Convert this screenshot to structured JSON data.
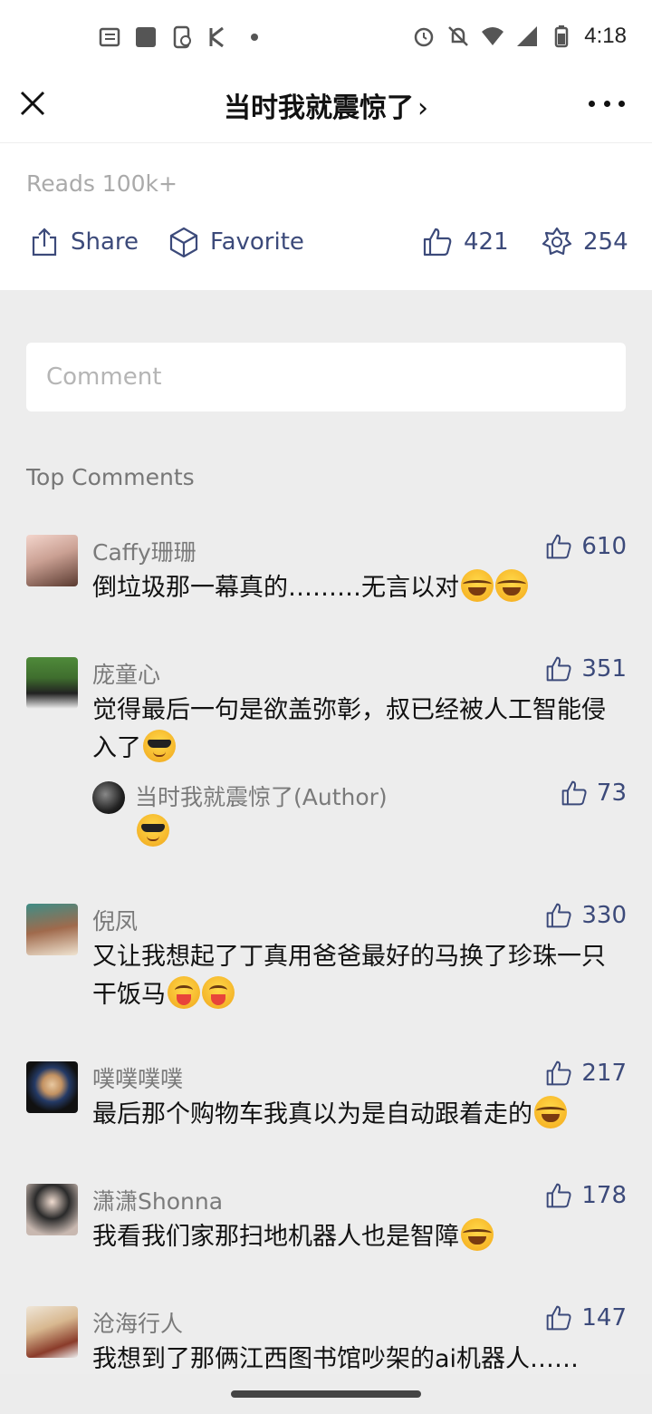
{
  "status_bar": {
    "time": "4:18"
  },
  "header": {
    "title": "当时我就震惊了",
    "chevron": "›"
  },
  "article": {
    "reads": "Reads 100k+"
  },
  "actions": {
    "share_label": "Share",
    "favorite_label": "Favorite",
    "like_count": "421",
    "wow_count": "254"
  },
  "comment_input": {
    "placeholder": "Comment"
  },
  "section_title": "Top Comments",
  "comments": [
    {
      "user": "Caffy珊珊",
      "likes": "610",
      "text": "倒垃圾那一幕真的………无言以对"
    },
    {
      "user": "庞童心",
      "likes": "351",
      "text": "觉得最后一句是欲盖弥彰，叔已经被人工智能侵入了",
      "reply": {
        "user": "当时我就震惊了(Author)",
        "likes": "73"
      }
    },
    {
      "user": "倪凤",
      "likes": "330",
      "text": "又让我想起了丁真用爸爸最好的马换了珍珠一只干饭马"
    },
    {
      "user": "噗噗噗噗",
      "likes": "217",
      "text": "最后那个购物车我真以为是自动跟着走的"
    },
    {
      "user": "潇潇Shonna",
      "likes": "178",
      "text": "我看我们家那扫地机器人也是智障"
    },
    {
      "user": "沧海行人",
      "likes": "147",
      "text": "我想到了那俩江西图书馆吵架的ai机器人……"
    }
  ],
  "colors": {
    "accent": "#3c4a7a",
    "background": "#ededed"
  }
}
